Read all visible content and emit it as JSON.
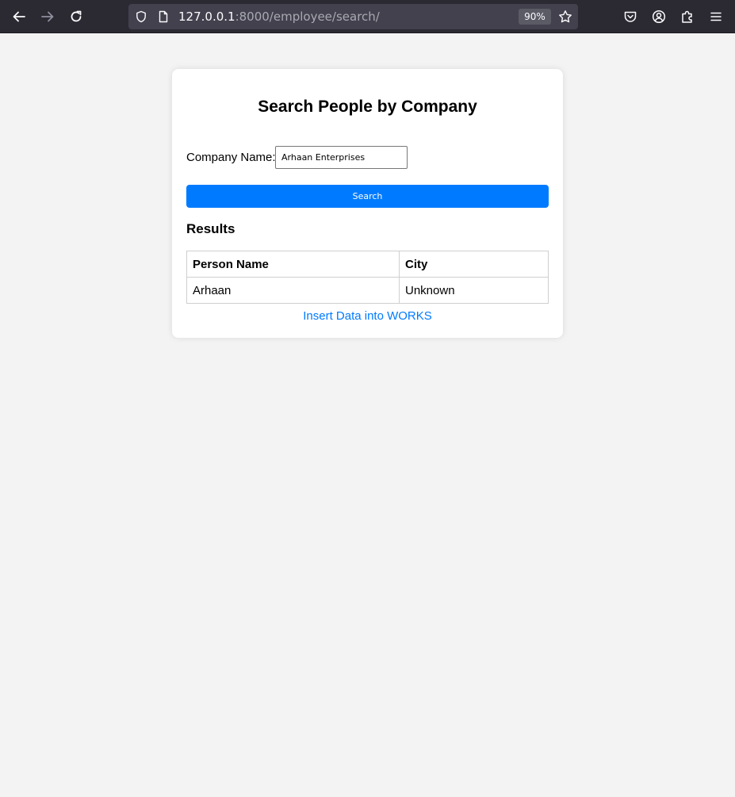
{
  "browser": {
    "url_host": "127.0.0.1",
    "url_rest": ":8000/employee/search/",
    "zoom": "90%"
  },
  "page": {
    "title": "Search People by Company",
    "form": {
      "label": "Company Name:",
      "company_value": "Arhaan Enterprises",
      "search_label": "Search"
    },
    "results": {
      "heading": "Results",
      "columns": [
        "Person Name",
        "City"
      ],
      "rows": [
        [
          "Arhaan",
          "Unknown"
        ]
      ]
    },
    "insert_link": "Insert Data into WORKS"
  },
  "colors": {
    "accent": "#007bff",
    "page_bg": "#f3f3f3",
    "toolbar_bg": "#2b2a33"
  }
}
